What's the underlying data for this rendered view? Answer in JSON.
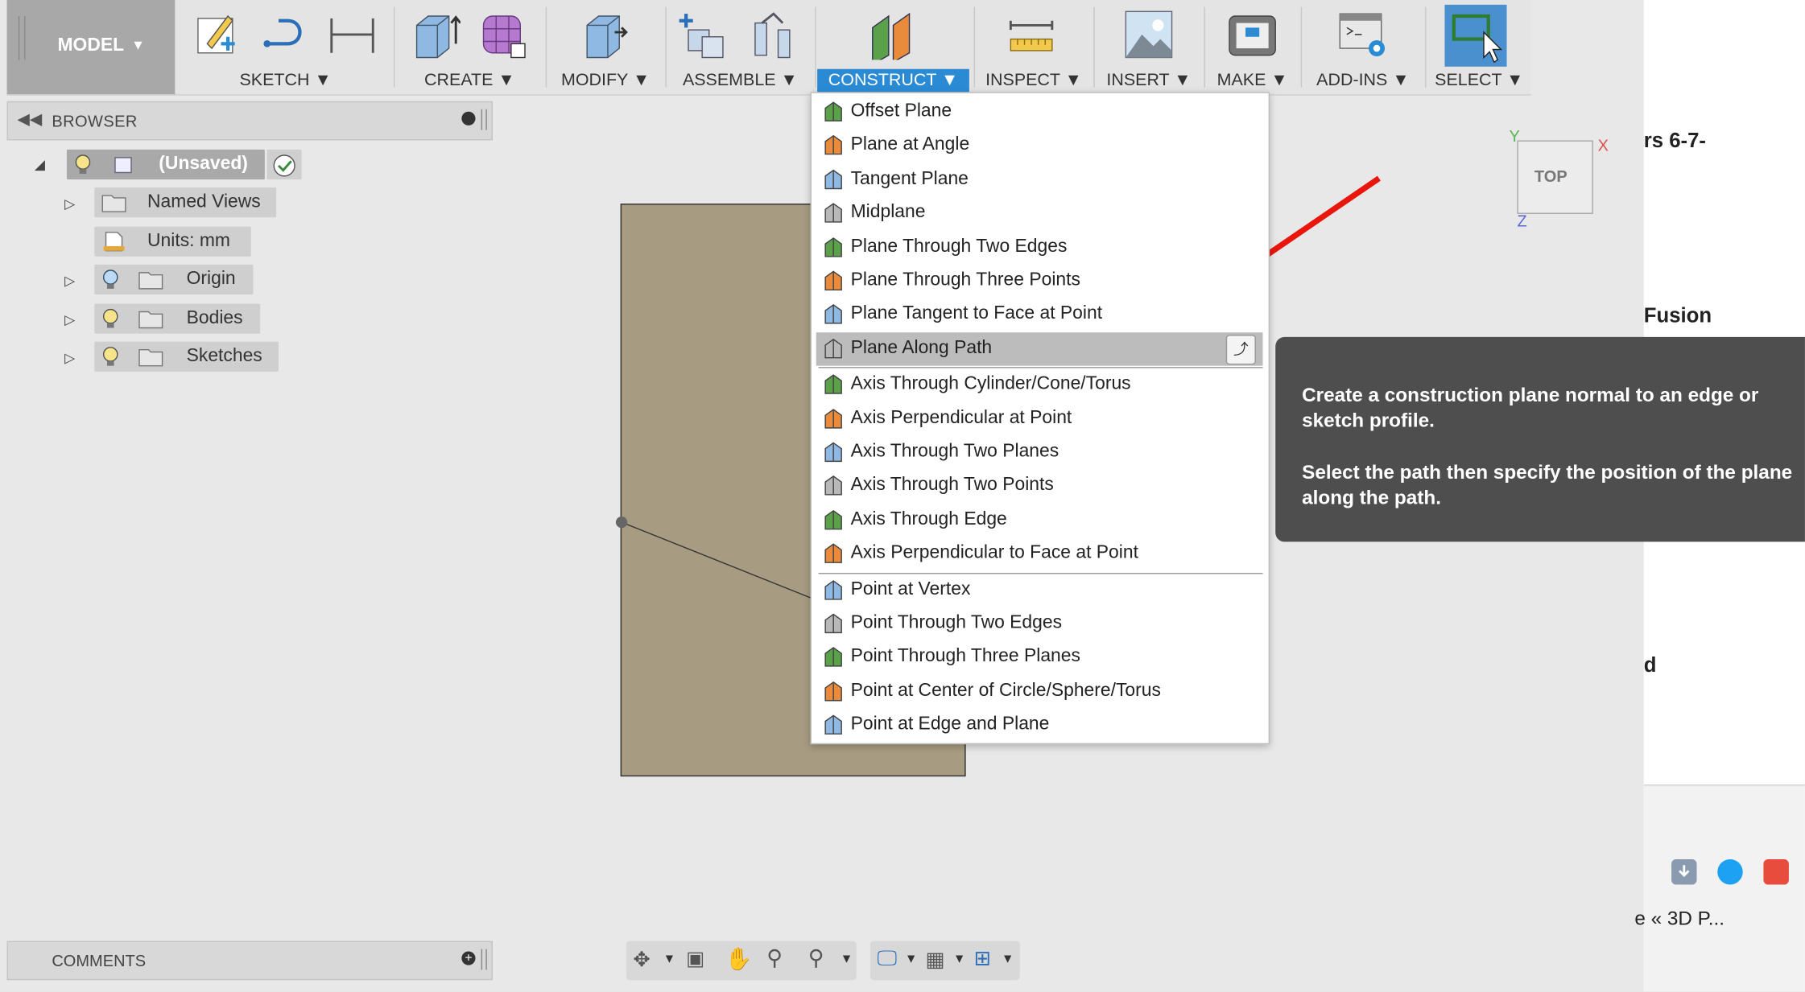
{
  "toolbar": {
    "workspace": "MODEL",
    "groups": [
      {
        "label": "SKETCH"
      },
      {
        "label": "CREATE"
      },
      {
        "label": "MODIFY"
      },
      {
        "label": "ASSEMBLE"
      },
      {
        "label": "CONSTRUCT"
      },
      {
        "label": "INSPECT"
      },
      {
        "label": "INSERT"
      },
      {
        "label": "MAKE"
      },
      {
        "label": "ADD-INS"
      },
      {
        "label": "SELECT"
      }
    ],
    "dropdown_arrow": "▼",
    "active_group": "CONSTRUCT",
    "accent_color": "#2a8bd4"
  },
  "browser": {
    "title": "BROWSER",
    "root": "(Unsaved)",
    "items": [
      {
        "label": "Named Views",
        "icon": "folder-icon"
      },
      {
        "label": "Units: mm",
        "icon": "units-icon"
      },
      {
        "label": "Origin",
        "icon": "folder-icon"
      },
      {
        "label": "Bodies",
        "icon": "folder-icon"
      },
      {
        "label": "Sketches",
        "icon": "folder-icon"
      }
    ]
  },
  "construct_menu": {
    "items": [
      {
        "label": "Offset Plane",
        "icon": "offset-plane-icon"
      },
      {
        "label": "Plane at Angle",
        "icon": "plane-angle-icon"
      },
      {
        "label": "Tangent Plane",
        "icon": "tangent-plane-icon"
      },
      {
        "label": "Midplane",
        "icon": "midplane-icon"
      },
      {
        "label": "Plane Through Two Edges",
        "icon": "plane-two-edges-icon"
      },
      {
        "label": "Plane Through Three Points",
        "icon": "plane-three-points-icon"
      },
      {
        "label": "Plane Tangent to Face at Point",
        "icon": "plane-tangent-face-icon"
      },
      {
        "label": "Plane Along Path",
        "icon": "plane-along-path-icon",
        "highlighted": true
      },
      {
        "label": "Axis Through Cylinder/Cone/Torus",
        "icon": "axis-cylinder-icon"
      },
      {
        "label": "Axis Perpendicular at Point",
        "icon": "axis-perp-point-icon"
      },
      {
        "label": "Axis Through Two Planes",
        "icon": "axis-two-planes-icon"
      },
      {
        "label": "Axis Through Two Points",
        "icon": "axis-two-points-icon"
      },
      {
        "label": "Axis Through Edge",
        "icon": "axis-edge-icon"
      },
      {
        "label": "Axis Perpendicular to Face at Point",
        "icon": "axis-perp-face-icon"
      },
      {
        "label": "Point at Vertex",
        "icon": "point-vertex-icon"
      },
      {
        "label": "Point Through Two Edges",
        "icon": "point-two-edges-icon"
      },
      {
        "label": "Point Through Three Planes",
        "icon": "point-three-planes-icon"
      },
      {
        "label": "Point at Center of Circle/Sphere/Torus",
        "icon": "point-center-icon"
      },
      {
        "label": "Point at Edge and Plane",
        "icon": "point-edge-plane-icon"
      }
    ]
  },
  "tooltip": {
    "line1": "Create a construction plane normal to an edge or sketch profile.",
    "line2": "Select the path then specify the position of the plane along the path."
  },
  "viewcube": {
    "face": "TOP",
    "axis_x": "X",
    "axis_y": "Y",
    "axis_z": "Z"
  },
  "comments": {
    "title": "COMMENTS"
  },
  "background_page": {
    "fragment1": "rs 6-7-",
    "fragment2": "Fusion",
    "fragment3": "d",
    "fragment4": "e « 3D P..."
  }
}
